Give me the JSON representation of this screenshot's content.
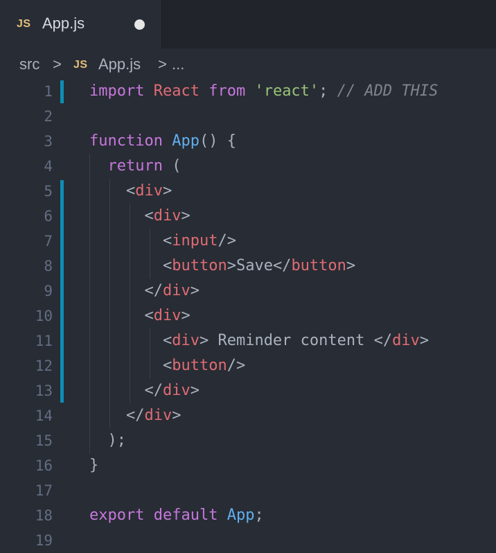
{
  "tab": {
    "icon_label": "JS",
    "filename": "App.js"
  },
  "breadcrumb": {
    "folder": "src",
    "separator": ">",
    "icon_label": "JS",
    "file": "App.js",
    "more": "..."
  },
  "editor": {
    "line_numbers": [
      "1",
      "2",
      "3",
      "4",
      "5",
      "6",
      "7",
      "8",
      "9",
      "10",
      "11",
      "12",
      "13",
      "14",
      "15",
      "16",
      "17",
      "18",
      "19"
    ],
    "line1": {
      "kw1": "import",
      "id": "React",
      "kw2": "from",
      "str": "'react'",
      "semi": ";",
      "comment": "// ADD THIS"
    },
    "line3": {
      "kw": "function",
      "fn": "App",
      "rest": "() {"
    },
    "line4": {
      "kw": "return",
      "rest": "("
    },
    "line5": {
      "open": "<",
      "tag": "div",
      "close": ">"
    },
    "line6": {
      "open": "<",
      "tag": "div",
      "close": ">"
    },
    "line7": {
      "open": "<",
      "tag": "input",
      "close": "/>"
    },
    "line8": {
      "open": "<",
      "tag": "button",
      "mid": ">",
      "text": "Save",
      "open2": "</",
      "tag2": "button",
      "close": ">"
    },
    "line9": {
      "open": "</",
      "tag": "div",
      "close": ">"
    },
    "line10": {
      "open": "<",
      "tag": "div",
      "close": ">"
    },
    "line11": {
      "open": "<",
      "tag": "div",
      "mid": ">",
      "text": " Reminder content ",
      "open2": "</",
      "tag2": "div",
      "close": ">"
    },
    "line12": {
      "open": "<",
      "tag": "button",
      "close": "/>"
    },
    "line13": {
      "open": "</",
      "tag": "div",
      "close": ">"
    },
    "line14": {
      "open": "</",
      "tag": "div",
      "close": ">"
    },
    "line15": {
      "text": ");"
    },
    "line16": {
      "text": "}"
    },
    "line18": {
      "kw1": "export",
      "kw2": "default",
      "fn": "App",
      "semi": ";"
    }
  }
}
